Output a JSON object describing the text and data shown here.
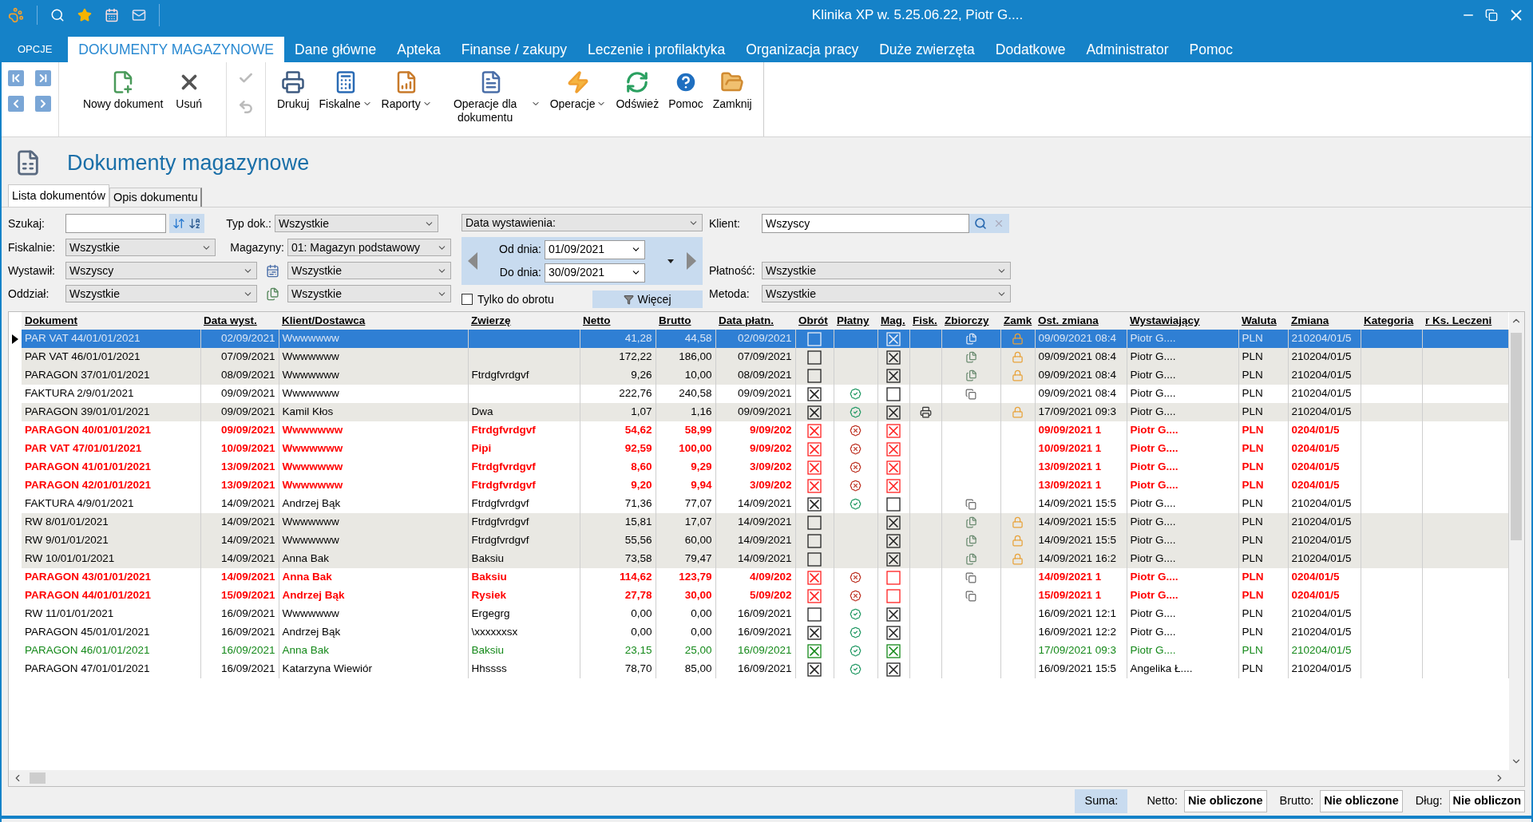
{
  "window": {
    "title": "Klinika XP w. 5.25.06.22, Piotr G...."
  },
  "ribbon_tabs": [
    {
      "label": "OPCJE",
      "kind": "menu",
      "selected": false
    },
    {
      "label": "DOKUMENTY MAGAZYNOWE",
      "kind": "tab",
      "selected": true
    },
    {
      "label": "Dane główne",
      "kind": "tab",
      "selected": false
    },
    {
      "label": "Apteka",
      "kind": "tab",
      "selected": false
    },
    {
      "label": "Finanse / zakupy",
      "kind": "tab",
      "selected": false
    },
    {
      "label": "Leczenie i profilaktyka",
      "kind": "tab",
      "selected": false
    },
    {
      "label": "Organizacja pracy",
      "kind": "tab",
      "selected": false
    },
    {
      "label": "Duże zwierzęta",
      "kind": "tab",
      "selected": false
    },
    {
      "label": "Dodatkowe",
      "kind": "tab",
      "selected": false
    },
    {
      "label": "Administrator",
      "kind": "tab",
      "selected": false
    },
    {
      "label": "Pomoc",
      "kind": "tab",
      "selected": false
    }
  ],
  "nav_buttons": [
    {
      "kind": "first"
    },
    {
      "kind": "last"
    },
    {
      "kind": "prev"
    },
    {
      "kind": "next"
    }
  ],
  "edit_buttons": [
    {
      "label": "Nowy dokument",
      "kind": "new"
    },
    {
      "label": "Usuń",
      "kind": "delete"
    }
  ],
  "confirm_buttons": [
    {
      "kind": "confirm",
      "disabled": true
    },
    {
      "kind": "undo",
      "disabled": true
    }
  ],
  "tool_buttons": [
    {
      "label": "Drukuj",
      "kind": "print",
      "dropdown": false
    },
    {
      "label": "Fiskalne",
      "kind": "fiscal",
      "dropdown": true
    },
    {
      "label": "Raporty",
      "kind": "reports",
      "dropdown": true
    },
    {
      "label": "Operacje dla dokumentu",
      "kind": "doc_ops",
      "dropdown": true
    },
    {
      "label": "Operacje",
      "kind": "ops",
      "dropdown": true
    },
    {
      "label": "Odśwież",
      "kind": "refresh",
      "dropdown": false
    },
    {
      "label": "Pomoc",
      "kind": "help",
      "dropdown": false
    },
    {
      "label": "Zamknij",
      "kind": "close",
      "dropdown": false
    }
  ],
  "page_title": "Dokumenty magazynowe",
  "view_tabs": [
    {
      "label": "Lista dokumentów",
      "selected": true
    },
    {
      "label": "Opis dokumentu",
      "selected": false
    }
  ],
  "filters": {
    "search": {
      "label": "Szukaj:"
    },
    "doc_type": {
      "label": "Typ dok.:",
      "value": "Wszystkie"
    },
    "fiscal": {
      "label": "Fiskalnie:",
      "value": "Wszystkie"
    },
    "warehouses": {
      "label": "Magazyny:",
      "value": "01: Magazyn podstawowy"
    },
    "issuer": {
      "label": "Wystawił:",
      "value": "Wszyscy"
    },
    "issuer_extra": {
      "value": "Wszystkie"
    },
    "branch": {
      "label": "Oddział:",
      "value": "Wszystkie"
    },
    "branch_extra": {
      "value": "Wszystkie"
    },
    "date_field": {
      "value": "Data wystawienia:"
    },
    "date_from": {
      "label": "Od dnia:",
      "value": "01/09/2021"
    },
    "date_to": {
      "label": "Do dnia:",
      "value": "30/09/2021"
    },
    "turnover_only": {
      "label": "Tylko do obrotu",
      "checked": false
    },
    "more_button": "Więcej",
    "client": {
      "label": "Klient:",
      "value": "Wszyscy"
    },
    "payment": {
      "label": "Płatność:",
      "value": "Wszystkie"
    },
    "method": {
      "label": "Metoda:",
      "value": "Wszystkie"
    }
  },
  "table": {
    "columns": [
      "Dokument",
      "Data wyst.",
      "Klient/Dostawca",
      "Zwierzę",
      "Netto",
      "Brutto",
      "Data płatn.",
      "Obrót",
      "Płatny",
      "Mag.",
      "Fisk.",
      "Zbiorczy",
      "Zamk",
      "Ost. zmiana",
      "Wystawiający",
      "Waluta",
      "Zmiana",
      "Kategoria",
      "r Ks. Leczeni"
    ],
    "rows": [
      {
        "kind": "normal",
        "selected": true,
        "doc": "PAR VAT 44/01/01/2021",
        "issued": "02/09/2021",
        "client": "Wwwwwww",
        "net": "41,28",
        "gross": "44,58",
        "due": "02/09/2021",
        "turnover": false,
        "payment": {
          "kind": "none"
        },
        "stock": true,
        "fiscal": false,
        "collective": {
          "kind": "merged"
        },
        "locked": true,
        "changed": "09/09/2021 08:4",
        "issuer": "Piotr G....",
        "currency": "PLN",
        "change": "210204/01/5"
      },
      {
        "kind": "normal",
        "selected": false,
        "doc": "PAR VAT 46/01/01/2021",
        "issued": "07/09/2021",
        "client": "Wwwwwww",
        "net": "172,22",
        "gross": "186,00",
        "due": "07/09/2021",
        "turnover": false,
        "payment": {
          "kind": "none"
        },
        "stock": true,
        "fiscal": false,
        "collective": {
          "kind": "merged"
        },
        "locked": true,
        "changed": "09/09/2021 08:4",
        "issuer": "Piotr G....",
        "currency": "PLN",
        "change": "210204/01/5"
      },
      {
        "kind": "normal",
        "selected": false,
        "doc": "PARAGON 37/01/01/2021",
        "issued": "08/09/2021",
        "client": "Wwwwwww",
        "animal": "Ftrdgfvrdgvf",
        "net": "9,26",
        "gross": "10,00",
        "due": "08/09/2021",
        "turnover": false,
        "payment": {
          "kind": "none"
        },
        "stock": true,
        "fiscal": false,
        "collective": {
          "kind": "merged"
        },
        "locked": true,
        "changed": "09/09/2021 08:4",
        "issuer": "Piotr G....",
        "currency": "PLN",
        "change": "210204/01/5"
      },
      {
        "kind": "normal",
        "selected": false,
        "doc": "FAKTURA 2/9/01/2021",
        "issued": "09/09/2021",
        "client": "Wwwwwww",
        "net": "222,76",
        "gross": "240,58",
        "due": "09/09/2021",
        "turnover": true,
        "payment": {
          "kind": "paid"
        },
        "stock": false,
        "fiscal": false,
        "collective": {
          "kind": "copy"
        },
        "locked": false,
        "changed": "09/09/2021 08:4",
        "issuer": "Piotr G....",
        "currency": "PLN",
        "change": "210204/01/5"
      },
      {
        "kind": "normal",
        "selected": false,
        "doc": "PARAGON 39/01/01/2021",
        "issued": "09/09/2021",
        "client": "Kamil Kłos",
        "animal": "Dwa",
        "net": "1,07",
        "gross": "1,16",
        "due": "09/09/2021",
        "turnover": true,
        "payment": {
          "kind": "paid"
        },
        "stock": true,
        "fiscal": true,
        "collective": {
          "kind": "none"
        },
        "locked": true,
        "changed": "17/09/2021 09:3",
        "issuer": "Piotr G....",
        "currency": "PLN",
        "change": "210204/01/5"
      },
      {
        "kind": "alert",
        "selected": false,
        "doc": "PARAGON 40/01/01/2021",
        "issued": "09/09/2021",
        "client": "Wwwwwww",
        "animal": "Ftrdgfvrdgvf",
        "net": "54,62",
        "gross": "58,99",
        "due": "9/09/202",
        "turnover": true,
        "payment": {
          "kind": "unpaid"
        },
        "stock": true,
        "fiscal": false,
        "collective": {
          "kind": "none"
        },
        "locked": false,
        "changed": "09/09/2021 1",
        "issuer": "Piotr G....",
        "currency": "PLN",
        "change": "0204/01/5"
      },
      {
        "kind": "alert",
        "selected": false,
        "doc": "PAR VAT 47/01/01/2021",
        "issued": "10/09/2021",
        "client": "Wwwwwww",
        "animal": "Pipi",
        "net": "92,59",
        "gross": "100,00",
        "due": "9/09/202",
        "turnover": true,
        "payment": {
          "kind": "unpaid"
        },
        "stock": true,
        "fiscal": false,
        "collective": {
          "kind": "none"
        },
        "locked": false,
        "changed": "10/09/2021 1",
        "issuer": "Piotr G....",
        "currency": "PLN",
        "change": "0204/01/5"
      },
      {
        "kind": "alert",
        "selected": false,
        "doc": "PARAGON 41/01/01/2021",
        "issued": "13/09/2021",
        "client": "Wwwwwww",
        "animal": "Ftrdgfvrdgvf",
        "net": "8,60",
        "gross": "9,29",
        "due": "3/09/202",
        "turnover": true,
        "payment": {
          "kind": "unpaid"
        },
        "stock": true,
        "fiscal": false,
        "collective": {
          "kind": "none"
        },
        "locked": false,
        "changed": "13/09/2021 1",
        "issuer": "Piotr G....",
        "currency": "PLN",
        "change": "0204/01/5"
      },
      {
        "kind": "alert",
        "selected": false,
        "doc": "PARAGON 42/01/01/2021",
        "issued": "13/09/2021",
        "client": "Wwwwwww",
        "animal": "Ftrdgfvrdgvf",
        "net": "9,20",
        "gross": "9,94",
        "due": "3/09/202",
        "turnover": true,
        "payment": {
          "kind": "unpaid"
        },
        "stock": true,
        "fiscal": false,
        "collective": {
          "kind": "none"
        },
        "locked": false,
        "changed": "13/09/2021 1",
        "issuer": "Piotr G....",
        "currency": "PLN",
        "change": "0204/01/5"
      },
      {
        "kind": "normal",
        "selected": false,
        "doc": "FAKTURA 4/9/01/2021",
        "issued": "14/09/2021",
        "client": "Andrzej Bąk",
        "animal": "Ftrdgfvrdgvf",
        "net": "71,36",
        "gross": "77,07",
        "due": "14/09/2021",
        "turnover": true,
        "payment": {
          "kind": "paid"
        },
        "stock": false,
        "fiscal": false,
        "collective": {
          "kind": "copy"
        },
        "locked": false,
        "changed": "14/09/2021 15:5",
        "issuer": "Piotr G....",
        "currency": "PLN",
        "change": "210204/01/5"
      },
      {
        "kind": "normal",
        "selected": false,
        "doc": "RW 8/01/01/2021",
        "issued": "14/09/2021",
        "client": "Wwwwwww",
        "animal": "Ftrdgfvrdgvf",
        "net": "15,81",
        "gross": "17,07",
        "due": "14/09/2021",
        "turnover": false,
        "payment": {
          "kind": "none"
        },
        "stock": true,
        "fiscal": false,
        "collective": {
          "kind": "merged"
        },
        "locked": true,
        "changed": "14/09/2021 15:5",
        "issuer": "Piotr G....",
        "currency": "PLN",
        "change": "210204/01/5"
      },
      {
        "kind": "normal",
        "selected": false,
        "doc": "RW 9/01/01/2021",
        "issued": "14/09/2021",
        "client": "Wwwwwww",
        "animal": "Ftrdgfvrdgvf",
        "net": "55,56",
        "gross": "60,00",
        "due": "14/09/2021",
        "turnover": false,
        "payment": {
          "kind": "none"
        },
        "stock": true,
        "fiscal": false,
        "collective": {
          "kind": "merged"
        },
        "locked": true,
        "changed": "14/09/2021 15:5",
        "issuer": "Piotr G....",
        "currency": "PLN",
        "change": "210204/01/5"
      },
      {
        "kind": "normal",
        "selected": false,
        "doc": "RW 10/01/01/2021",
        "issued": "14/09/2021",
        "client": "Anna Bak",
        "animal": "Baksiu",
        "net": "73,58",
        "gross": "79,47",
        "due": "14/09/2021",
        "turnover": false,
        "payment": {
          "kind": "none"
        },
        "stock": true,
        "fiscal": false,
        "collective": {
          "kind": "merged"
        },
        "locked": true,
        "changed": "14/09/2021 16:2",
        "issuer": "Piotr G....",
        "currency": "PLN",
        "change": "210204/01/5"
      },
      {
        "kind": "alert",
        "selected": false,
        "doc": "PARAGON 43/01/01/2021",
        "issued": "14/09/2021",
        "client": "Anna Bak",
        "animal": "Baksiu",
        "net": "114,62",
        "gross": "123,79",
        "due": "4/09/202",
        "turnover": true,
        "payment": {
          "kind": "unpaid"
        },
        "stock": false,
        "fiscal": false,
        "collective": {
          "kind": "copy"
        },
        "locked": false,
        "changed": "14/09/2021 1",
        "issuer": "Piotr G....",
        "currency": "PLN",
        "change": "0204/01/5"
      },
      {
        "kind": "alert",
        "selected": false,
        "doc": "PARAGON 44/01/01/2021",
        "issued": "15/09/2021",
        "client": "Andrzej Bąk",
        "animal": "Rysiek",
        "net": "27,78",
        "gross": "30,00",
        "due": "5/09/202",
        "turnover": true,
        "payment": {
          "kind": "unpaid"
        },
        "stock": false,
        "fiscal": false,
        "collective": {
          "kind": "copy"
        },
        "locked": false,
        "changed": "15/09/2021 1",
        "issuer": "Piotr G....",
        "currency": "PLN",
        "change": "0204/01/5"
      },
      {
        "kind": "normal",
        "selected": false,
        "doc": "RW 11/01/01/2021",
        "issued": "16/09/2021",
        "client": "Wwwwwww",
        "animal": "Ergegrg",
        "net": "0,00",
        "gross": "0,00",
        "due": "16/09/2021",
        "turnover": false,
        "payment": {
          "kind": "paid"
        },
        "stock": true,
        "fiscal": false,
        "collective": {
          "kind": "none"
        },
        "locked": false,
        "changed": "16/09/2021 12:1",
        "issuer": "Piotr G....",
        "currency": "PLN",
        "change": "210204/01/5"
      },
      {
        "kind": "normal",
        "selected": false,
        "doc": "PARAGON 45/01/01/2021",
        "issued": "16/09/2021",
        "client": "Andrzej Bąk",
        "animal": "\\xxxxxxsx",
        "net": "0,00",
        "gross": "0,00",
        "due": "16/09/2021",
        "turnover": true,
        "payment": {
          "kind": "paid"
        },
        "stock": true,
        "fiscal": false,
        "collective": {
          "kind": "none"
        },
        "locked": false,
        "changed": "16/09/2021 12:2",
        "issuer": "Piotr G....",
        "currency": "PLN",
        "change": "210204/01/5"
      },
      {
        "kind": "done",
        "selected": false,
        "doc": "PARAGON 46/01/01/2021",
        "issued": "16/09/2021",
        "client": "Anna Bak",
        "animal": "Baksiu",
        "net": "23,15",
        "gross": "25,00",
        "due": "16/09/2021",
        "turnover": true,
        "payment": {
          "kind": "paid"
        },
        "stock": true,
        "fiscal": false,
        "collective": {
          "kind": "none"
        },
        "locked": false,
        "changed": "17/09/2021 09:3",
        "issuer": "Piotr G....",
        "currency": "PLN",
        "change": "210204/01/5"
      },
      {
        "kind": "normal",
        "selected": false,
        "doc": "PARAGON 47/01/01/2021",
        "issued": "16/09/2021",
        "client": "Katarzyna Wiewiór",
        "animal": "Hhssss",
        "net": "78,70",
        "gross": "85,00",
        "due": "16/09/2021",
        "turnover": true,
        "payment": {
          "kind": "paid"
        },
        "stock": true,
        "fiscal": false,
        "collective": {
          "kind": "none"
        },
        "locked": false,
        "changed": "16/09/2021 15:5",
        "issuer": "Angelika Ł....",
        "currency": "PLN",
        "change": "210204/01/5"
      }
    ]
  },
  "summary": {
    "label": "Suma:",
    "fields": [
      {
        "label": "Netto:",
        "value": "Nie obliczone"
      },
      {
        "label": "Brutto:",
        "value": "Nie obliczone"
      },
      {
        "label": "Dług:",
        "value": "Nie obliczon"
      }
    ]
  }
}
